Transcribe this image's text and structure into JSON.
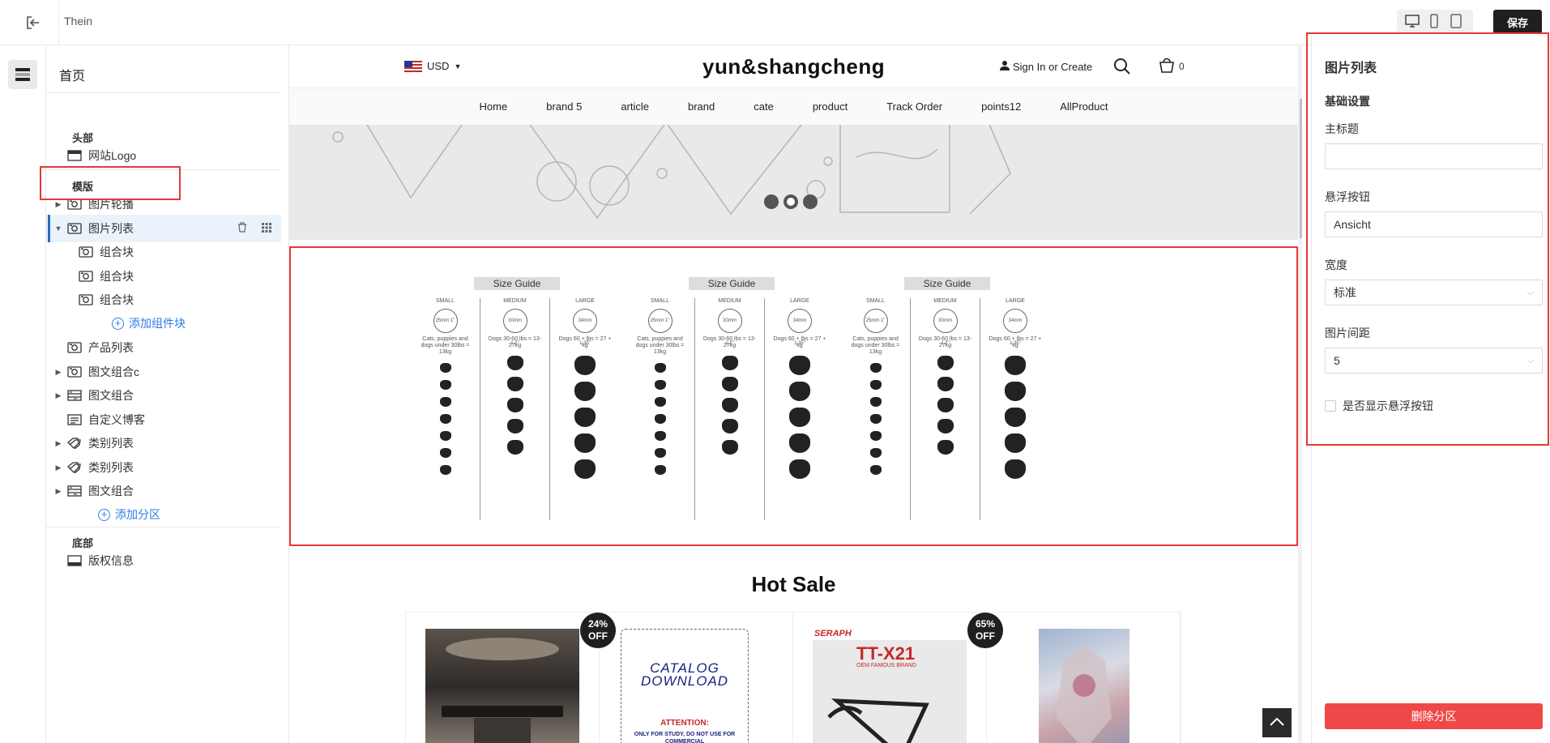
{
  "topbar": {
    "store_name": "Thein",
    "save_label": "保存",
    "devices": [
      "desktop-icon",
      "mobile-icon",
      "tablet-icon"
    ]
  },
  "tree": {
    "page_name": "首页",
    "header_group": "头部",
    "header_items": [
      {
        "label": "网站Logo",
        "icon": "header-block-icon"
      }
    ],
    "template_group": "模版",
    "template_items": [
      {
        "label": "图片轮播",
        "icon": "image-icon",
        "expandable": true
      },
      {
        "label": "图片列表",
        "icon": "image-icon",
        "expandable": true,
        "expanded": true,
        "selected": true
      },
      {
        "label": "组合块",
        "icon": "image-icon",
        "child": true
      },
      {
        "label": "组合块",
        "icon": "image-icon",
        "child": true
      },
      {
        "label": "组合块",
        "icon": "image-icon",
        "child": true
      },
      {
        "label": "产品列表",
        "icon": "image-icon"
      },
      {
        "label": "图文组合c",
        "icon": "image-icon",
        "expandable": true
      },
      {
        "label": "图文组合",
        "icon": "image-text-icon",
        "expandable": true
      },
      {
        "label": "自定义博客",
        "icon": "blog-icon"
      },
      {
        "label": "类别列表",
        "icon": "tag-icon",
        "expandable": true
      },
      {
        "label": "类别列表",
        "icon": "tag-icon",
        "expandable": true
      },
      {
        "label": "图文组合",
        "icon": "image-text-icon",
        "expandable": true
      }
    ],
    "add_block_label": "添加组件块",
    "add_section_label": "添加分区",
    "footer_group": "底部",
    "footer_items": [
      {
        "label": "版权信息",
        "icon": "footer-block-icon"
      }
    ]
  },
  "preview": {
    "currency": "USD",
    "logo": "yun&shangcheng",
    "signin": "Sign In or Create",
    "cart_count": "0",
    "nav": [
      "Home",
      "brand 5",
      "article",
      "brand",
      "cate",
      "product",
      "Track Order",
      "points12",
      "AllProduct"
    ],
    "size_guide": {
      "title": "Size Guide",
      "columns": [
        {
          "name": "SMALL",
          "size": "25mm 1\"",
          "note": "Cats, puppies and dogs under 30lbs = 13kg"
        },
        {
          "name": "MEDIUM",
          "size": "30mm 1.2\"",
          "note": "Dogs 30-60 lbs = 13-27kg"
        },
        {
          "name": "LARGE",
          "size": "34mm 1.35\"",
          "note": "Dogs 60 + lbs = 27 + kg"
        }
      ],
      "repeat": 3
    },
    "hot_sale_title": "Hot Sale",
    "products": [
      {
        "badge": "",
        "image": "interior-photo"
      },
      {
        "badge": "24%\nOFF",
        "image": "catalog-download"
      },
      {
        "badge": "",
        "image": "bike-frame"
      },
      {
        "badge": "65%\nOFF",
        "image": "anime-art"
      }
    ],
    "catalog_text": "CATALOG DOWNLOAD",
    "attention_text": "ATTENTION:",
    "attention_sub": "ONLY FOR STUDY, DO NOT USE FOR COMMERCIAL",
    "bike_brand": "SERAPH",
    "bike_model": "TT-X21",
    "bike_sub": "OEM FAMOUS BRAND"
  },
  "settings": {
    "title": "图片列表",
    "section": "基础设置",
    "main_title_label": "主标题",
    "main_title_value": "",
    "float_button_label": "悬浮按钮",
    "float_button_value": "Ansicht",
    "width_label": "宽度",
    "width_value": "标准",
    "spacing_label": "图片间距",
    "spacing_value": "5",
    "show_float_label": "是否显示悬浮按钮",
    "show_float_checked": false,
    "delete_label": "删除分区"
  },
  "colors": {
    "highlight": "#e53935",
    "link": "#2b7de9",
    "danger": "#f04848",
    "dark": "#1f1f1f"
  }
}
